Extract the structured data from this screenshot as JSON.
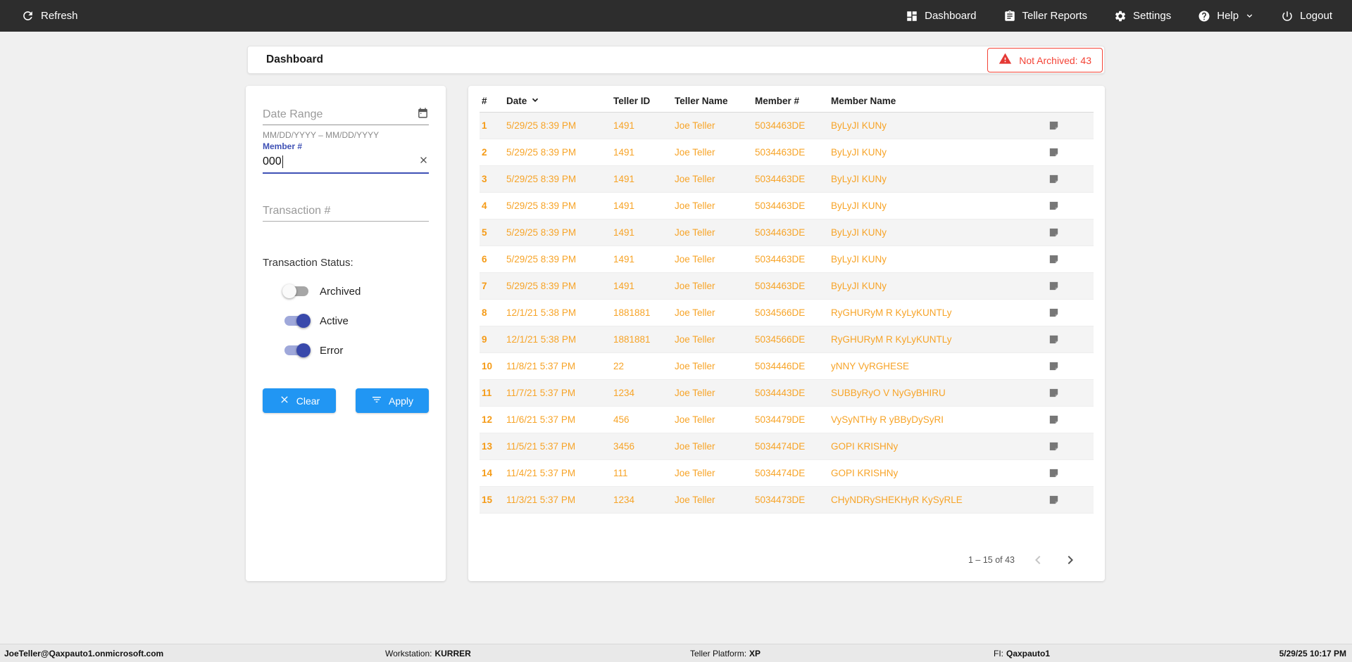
{
  "navbar": {
    "refresh_label": "Refresh",
    "items": [
      {
        "label": "Dashboard",
        "icon": "dashboard-icon"
      },
      {
        "label": "Teller Reports",
        "icon": "reports-icon"
      },
      {
        "label": "Settings",
        "icon": "settings-icon"
      },
      {
        "label": "Help",
        "icon": "help-icon"
      },
      {
        "label": "Logout",
        "icon": "logout-icon"
      }
    ]
  },
  "header": {
    "title": "Dashboard",
    "not_archived_badge": "Not Archived: 43"
  },
  "filters": {
    "date_range": {
      "placeholder": "Date Range",
      "hint": "MM/DD/YYYY – MM/DD/YYYY"
    },
    "member_number": {
      "label": "Member #",
      "value": "000"
    },
    "transaction_number": {
      "placeholder": "Transaction #"
    },
    "status_label": "Transaction Status:",
    "toggles": [
      {
        "label": "Archived",
        "on": false
      },
      {
        "label": "Active",
        "on": true
      },
      {
        "label": "Error",
        "on": true
      }
    ],
    "clear_label": "Clear",
    "apply_label": "Apply"
  },
  "table": {
    "columns": [
      "#",
      "Date",
      "Teller ID",
      "Teller Name",
      "Member #",
      "Member Name"
    ],
    "sorted_column": "Date",
    "rows": [
      [
        "1",
        "5/29/25 8:39 PM",
        "1491",
        "Joe Teller",
        "5034463DE",
        "ByLyJI KUNy"
      ],
      [
        "2",
        "5/29/25 8:39 PM",
        "1491",
        "Joe Teller",
        "5034463DE",
        "ByLyJI KUNy"
      ],
      [
        "3",
        "5/29/25 8:39 PM",
        "1491",
        "Joe Teller",
        "5034463DE",
        "ByLyJI KUNy"
      ],
      [
        "4",
        "5/29/25 8:39 PM",
        "1491",
        "Joe Teller",
        "5034463DE",
        "ByLyJI KUNy"
      ],
      [
        "5",
        "5/29/25 8:39 PM",
        "1491",
        "Joe Teller",
        "5034463DE",
        "ByLyJI KUNy"
      ],
      [
        "6",
        "5/29/25 8:39 PM",
        "1491",
        "Joe Teller",
        "5034463DE",
        "ByLyJI KUNy"
      ],
      [
        "7",
        "5/29/25 8:39 PM",
        "1491",
        "Joe Teller",
        "5034463DE",
        "ByLyJI KUNy"
      ],
      [
        "8",
        "12/1/21 5:38 PM",
        "1881881",
        "Joe Teller",
        "5034566DE",
        "RyGHURyM R KyLyKUNTLy"
      ],
      [
        "9",
        "12/1/21 5:38 PM",
        "1881881",
        "Joe Teller",
        "5034566DE",
        "RyGHURyM R KyLyKUNTLy"
      ],
      [
        "10",
        "11/8/21 5:37 PM",
        "22",
        "Joe Teller",
        "5034446DE",
        "yNNY VyRGHESE"
      ],
      [
        "11",
        "11/7/21 5:37 PM",
        "1234",
        "Joe Teller",
        "5034443DE",
        "SUBByRyO V NyGyBHIRU"
      ],
      [
        "12",
        "11/6/21 5:37 PM",
        "456",
        "Joe Teller",
        "5034479DE",
        "VySyNTHy R yBByDySyRI"
      ],
      [
        "13",
        "11/5/21 5:37 PM",
        "3456",
        "Joe Teller",
        "5034474DE",
        "GOPI KRISHNy"
      ],
      [
        "14",
        "11/4/21 5:37 PM",
        "111",
        "Joe Teller",
        "5034474DE",
        "GOPI KRISHNy"
      ],
      [
        "15",
        "11/3/21 5:37 PM",
        "1234",
        "Joe Teller",
        "5034473DE",
        "CHyNDRySHEKHyR KySyRLE"
      ]
    ],
    "pagination": {
      "range": "1 – 15 of 43"
    }
  },
  "statusbar": {
    "user": "JoeTeller@Qaxpauto1.onmicrosoft.com",
    "workstation_label": "Workstation:",
    "workstation": "KURRER",
    "platform_label": "Teller Platform:",
    "platform": "XP",
    "fi_label": "FI:",
    "fi": "Qaxpauto1",
    "datetime": "5/29/25 10:17 PM"
  },
  "colors": {
    "navbar_bg": "#2d2d2d",
    "accent_blue": "#2196f3",
    "toggle_indigo": "#3949ab",
    "row_orange": "#f7a428",
    "alert_red": "#f44336",
    "page_bg": "#f0f0f0"
  }
}
